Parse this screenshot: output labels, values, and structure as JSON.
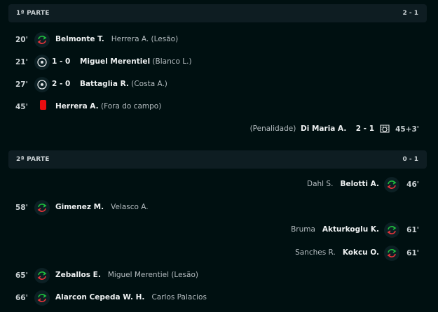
{
  "first_half": {
    "label": "1ª PARTE",
    "score": "2 - 1",
    "events": [
      {
        "minute": "20'",
        "player": "Belmonte T.",
        "detail": "Herrera A. (Lesão)",
        "icon": "substitution-icon"
      },
      {
        "minute": "21'",
        "score": "1 - 0",
        "player": "Miguel Merentiel",
        "detail": "(Blanco L.)",
        "icon": "goal-ball-icon"
      },
      {
        "minute": "27'",
        "score": "2 - 0",
        "player": "Battaglia R.",
        "detail": "(Costa A.)",
        "icon": "goal-ball-icon"
      },
      {
        "minute": "45'",
        "player": "Herrera A.",
        "detail": "(Fora do campo)",
        "icon": "red-card-icon"
      },
      {
        "minute": "45+3'",
        "detail": "(Penalidade)",
        "player": "Di Maria A.",
        "score": "2 - 1",
        "icon": "penalty-goal-icon"
      }
    ]
  },
  "second_half": {
    "label": "2ª PARTE",
    "score": "0 - 1",
    "events": [
      {
        "minute": "46'",
        "detail": "Dahl S.",
        "player": "Belotti A.",
        "icon": "substitution-icon"
      },
      {
        "minute": "58'",
        "player": "Gimenez M.",
        "detail": "Velasco A.",
        "icon": "substitution-icon"
      },
      {
        "minute": "61'",
        "detail": "Bruma",
        "player": "Akturkoglu K.",
        "icon": "substitution-icon"
      },
      {
        "minute": "61'",
        "detail": "Sanches R.",
        "player": "Kokcu O.",
        "icon": "substitution-icon"
      },
      {
        "minute": "65'",
        "player": "Zeballos E.",
        "detail": "Miguel Merentiel (Lesão)",
        "icon": "substitution-icon"
      },
      {
        "minute": "66'",
        "player": "Alarcon Cepeda W. H.",
        "detail": "Carlos Palacios",
        "icon": "substitution-icon"
      }
    ]
  },
  "colors": {
    "background": "#001011",
    "header": "#0e1d22",
    "sub_in": "#1fbf3e",
    "sub_out": "#e8343b",
    "red_card": "#e80d10"
  }
}
